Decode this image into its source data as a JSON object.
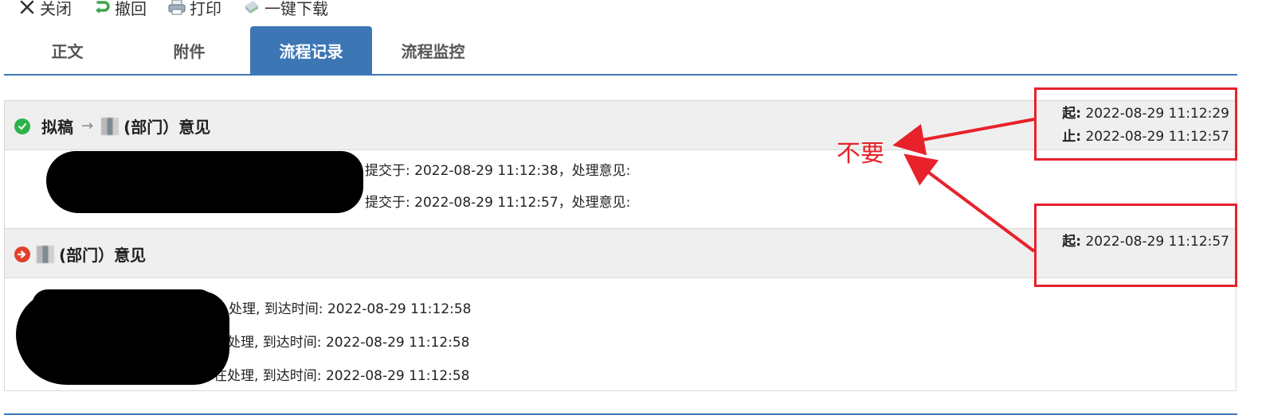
{
  "toolbar": {
    "close": "关闭",
    "undo": "撤回",
    "print": "打印",
    "download": "一键下载"
  },
  "tabs": [
    {
      "label": "正文",
      "active": false
    },
    {
      "label": "附件",
      "active": false
    },
    {
      "label": "流程记录",
      "active": true
    },
    {
      "label": "流程监控",
      "active": false
    }
  ],
  "records": [
    {
      "status": "completed",
      "title_from": "拟稿",
      "title_to": "(部门）意见",
      "start_label": "起:",
      "start_time": "2022-08-29 11:12:29",
      "end_label": "止:",
      "end_time": "2022-08-29 11:12:57",
      "lines": [
        "提交于:   2022-08-29 11:12:38，处理意见:",
        "提交于:   2022-08-29 11:12:57，处理意见:"
      ]
    },
    {
      "status": "in-progress",
      "title": "(部门）意见",
      "start_label": "起:",
      "start_time": "2022-08-29 11:12:57",
      "lines": [
        "处理, 到达时间: 2022-08-29 11:12:58",
        "在处理, 到达时间: 2022-08-29 11:12:58",
        "在处理, 到达时间: 2022-08-29 11:12:58"
      ]
    }
  ],
  "annotation": {
    "text": "不要",
    "color": "#e8212b"
  },
  "colors": {
    "tab_active": "#3d76b5",
    "header_bg": "#efefef",
    "status_ok": "#2bb24c",
    "status_next": "#e0412d"
  }
}
